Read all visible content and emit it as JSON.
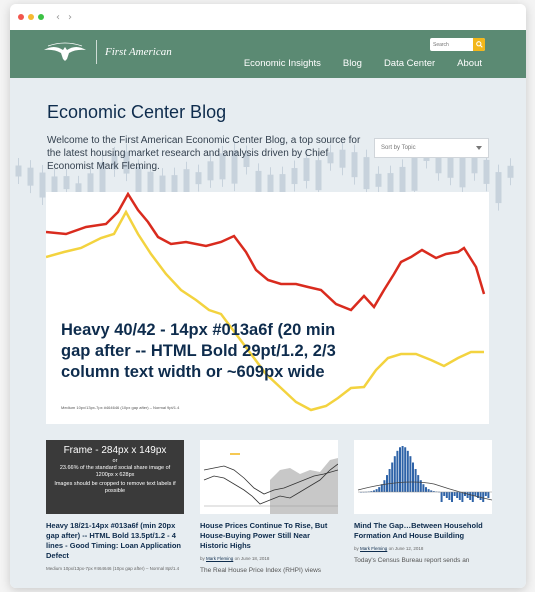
{
  "browser": {
    "back_icon": "‹",
    "forward_icon": "›"
  },
  "brand": {
    "name": "First American"
  },
  "search": {
    "placeholder": "Search"
  },
  "nav": [
    {
      "label": "Economic Insights"
    },
    {
      "label": "Blog"
    },
    {
      "label": "Data Center"
    },
    {
      "label": "About"
    }
  ],
  "page": {
    "title": "Economic Center Blog",
    "intro": "Welcome to the First American Economic Center Blog, a top source for the latest housing market research and analysis driven by Chief Economist Mark Fleming."
  },
  "sort": {
    "label": "Sort by Topic"
  },
  "feature": {
    "heavy_text": "Heavy 40/42 - 14px #013a6f (20 min gap after -- HTML Bold 29pt/1.2, 2/3 column text width or ~609px wide",
    "medium_text": "Medium 10px/13px-7px #464646 (10px gap after) – Normal 9pt/1.4"
  },
  "cards": [
    {
      "frame_title": "Frame - 284px x 149px",
      "frame_or": "or",
      "frame_text1": "23.66% of the standard social share image of 1200px x 628px",
      "frame_text2": "Images should be cropped to remove text labels if possible",
      "title": "Heavy 18/21-14px #013a6f (min 20px gap after) -- HTML Bold 13.5pt/1.2 - 4 lines - Good Timing: Loan Application Defect",
      "meta": "Medium 10px/13px-7px #464646 (10px gap after) – Normal 8pt/1.4"
    },
    {
      "title": "House Prices Continue To Rise, But House-Buying Power Still Near Historic Highs",
      "meta_prefix": "by",
      "author": "Mark Fleming",
      "meta_suffix": "on June 18, 2018",
      "excerpt": "The Real House Price Index (RHPI) views"
    },
    {
      "title": "Mind The Gap…Between Household Formation And House Building",
      "meta_prefix": "by",
      "author": "Mark Fleming",
      "meta_suffix": "on June 12, 2018",
      "excerpt": "Today's Census Bureau report sends an"
    }
  ],
  "colors": {
    "header": "#5b8a73",
    "accent": "#f2b71a",
    "title": "#0e2c4d",
    "red_line": "#d92b1e",
    "yellow_line": "#f3d33f"
  }
}
